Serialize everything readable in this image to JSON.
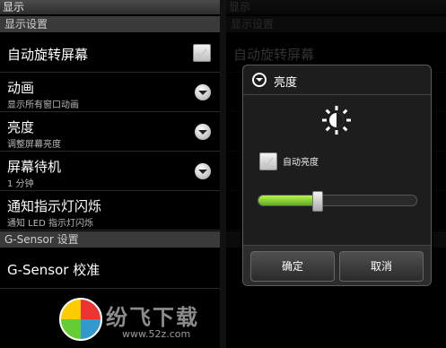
{
  "left": {
    "title": "显示",
    "section1": "显示设置",
    "rows": [
      {
        "title": "自动旋转屏幕",
        "subtitle": "",
        "control": "checkbox"
      },
      {
        "title": "动画",
        "subtitle": "显示所有窗口动画",
        "control": "dropdown"
      },
      {
        "title": "亮度",
        "subtitle": "调整屏幕亮度",
        "control": "dropdown"
      },
      {
        "title": "屏幕待机",
        "subtitle": "1 分钟",
        "control": "dropdown"
      },
      {
        "title": "通知指示灯闪烁",
        "subtitle": "通知 LED 指示灯闪烁",
        "control": "none"
      }
    ],
    "section2": "G-Sensor 设置",
    "gsensor": "G-Sensor 校准"
  },
  "right": {
    "title": "显示",
    "section1": "显示设置",
    "bg_row": "自动旋转屏幕",
    "dialog": {
      "title": "亮度",
      "auto_label": "自动亮度",
      "level": 0.37,
      "ok": "确定",
      "cancel": "取消"
    }
  },
  "watermark": {
    "text": "纷飞下载",
    "url": "www.52z.com"
  },
  "colors": {
    "accent_green": "#7dcf2a",
    "section_bg": "#3a3a3a"
  }
}
